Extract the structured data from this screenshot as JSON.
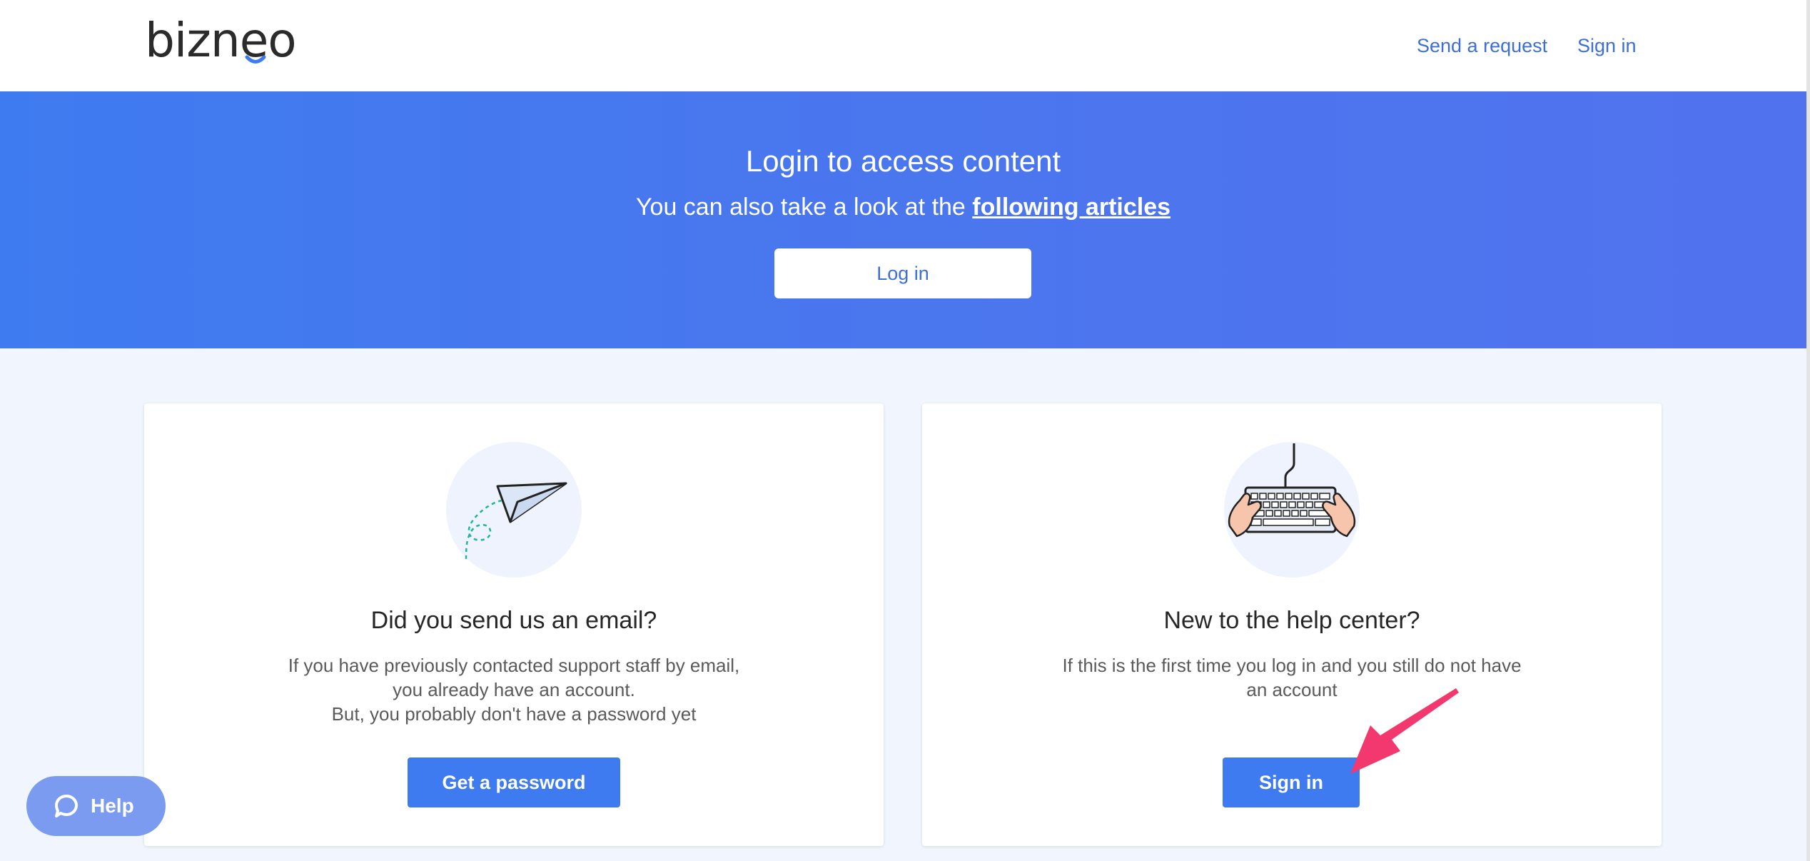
{
  "header": {
    "logo_text": "bizneo",
    "nav": {
      "send_request": "Send a request",
      "sign_in": "Sign in"
    }
  },
  "hero": {
    "title": "Login to access content",
    "subtitle_prefix": "You can also take a look at the ",
    "subtitle_link": "following articles",
    "login_button": "Log in"
  },
  "cards": [
    {
      "illustration": "paper-plane-icon",
      "title": "Did you send us an email?",
      "lines": [
        "If you have previously contacted support staff by email,",
        "you already have an account.",
        "But, you probably don't have a password yet"
      ],
      "button": "Get a password"
    },
    {
      "illustration": "keyboard-hands-icon",
      "title": "New to the help center?",
      "lines": [
        "If this is the first time you log in and you still do not have an account"
      ],
      "button": "Sign in"
    }
  ],
  "help_widget": {
    "label": "Help",
    "icon": "chat-bubble-icon"
  },
  "colors": {
    "brand_blue": "#3e7af0",
    "link_blue": "#3e6fd9",
    "hero_start": "#3f7bf0",
    "hero_end": "#5172ee",
    "annotation_pink": "#f2386f",
    "help_bg": "#7b9bf0",
    "page_bg": "#f1f6fe"
  }
}
